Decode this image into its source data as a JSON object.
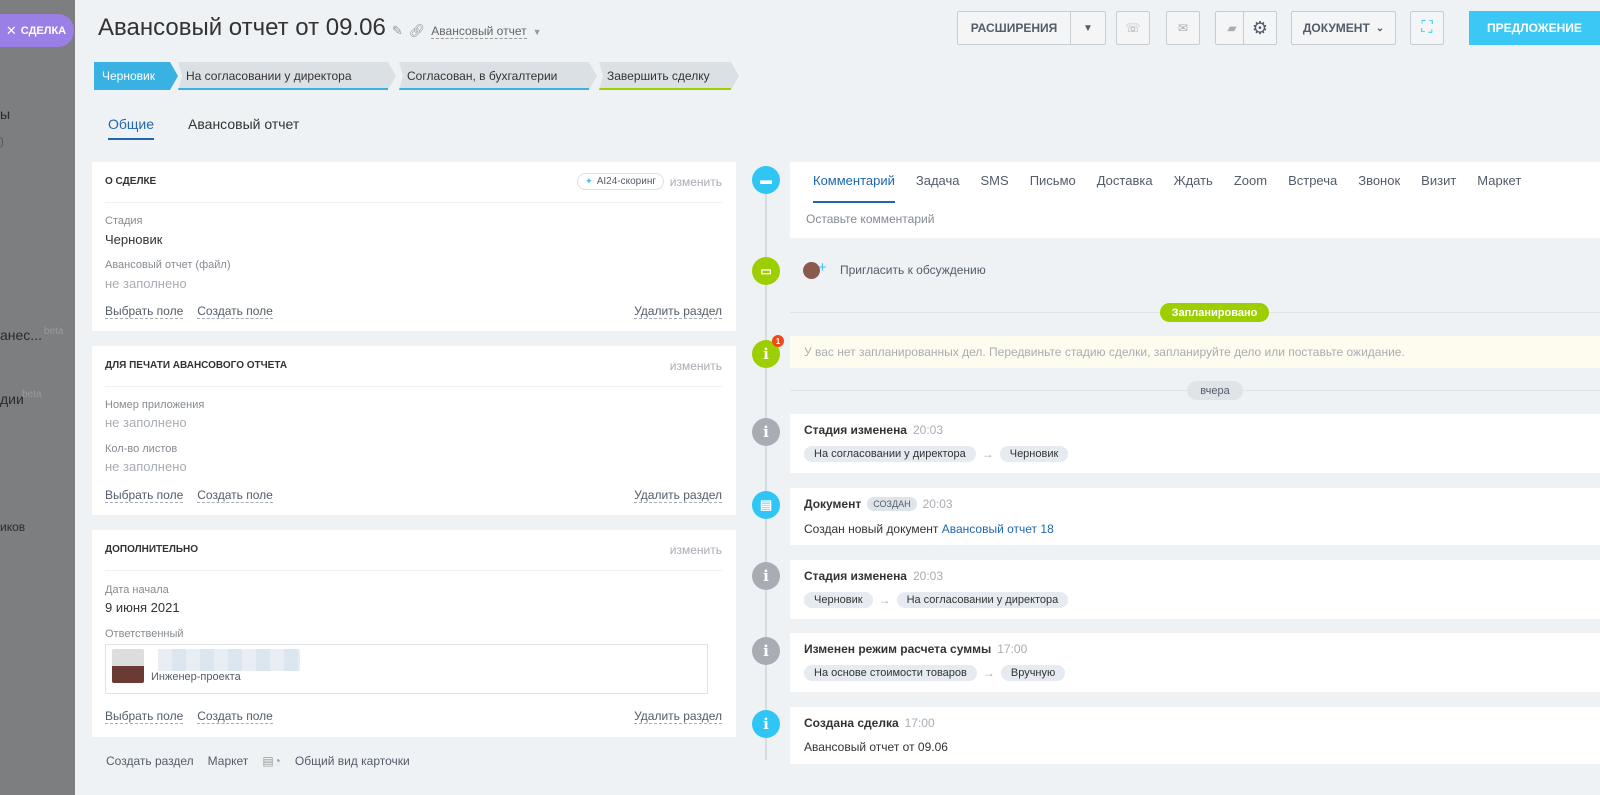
{
  "background": {
    "deal_tab_label": "СДЕЛКА",
    "menu_fragments": [
      "ы",
      ")",
      "анес...",
      "дии",
      "иков"
    ],
    "beta": "beta"
  },
  "header": {
    "title": "Авансовый отчет от  09.06",
    "category": "Авансовый отчет",
    "extensions_button": "Расширения",
    "document_button": "Документ",
    "proposal_button": "Предложение"
  },
  "stages": [
    {
      "label": "Черновик",
      "color": "#3ab1e3"
    },
    {
      "label": "На согласовании у директора",
      "color": "#3ab1e3"
    },
    {
      "label": "Согласован, в бухгалтерии",
      "color": "#3ab1e3"
    },
    {
      "label": "Завершить сделку",
      "color": "#9dcf00"
    }
  ],
  "tabs": [
    {
      "label": "Общие",
      "active": true
    },
    {
      "label": "Авансовый отчет",
      "active": false
    }
  ],
  "sections": {
    "about": {
      "title": "О сделке",
      "ai_badge": "AI24-скоринг",
      "edit": "изменить",
      "fields": [
        {
          "label": "Стадия",
          "value": "Черновик"
        },
        {
          "label": "Авансовый отчет (файл)",
          "value": "не заполнено"
        }
      ],
      "select_field": "Выбрать поле",
      "create_field": "Создать поле",
      "delete_section": "Удалить раздел"
    },
    "print": {
      "title": "Для печати авансового отчета",
      "edit": "изменить",
      "fields": [
        {
          "label": "Номер приложения",
          "value": "не заполнено"
        },
        {
          "label": "Кол-во листов",
          "value": "не заполнено"
        }
      ],
      "select_field": "Выбрать поле",
      "create_field": "Создать поле",
      "delete_section": "Удалить раздел"
    },
    "extra": {
      "title": "Дополнительно",
      "edit": "изменить",
      "start_label": "Дата начала",
      "start_value": "9 июня 2021",
      "resp_label": "Ответственный",
      "resp_role": "Инженер-проекта",
      "select_field": "Выбрать поле",
      "create_field": "Создать поле",
      "delete_section": "Удалить раздел"
    }
  },
  "footer": {
    "create_section": "Создать раздел",
    "market": "Маркет",
    "card_view": "Общий вид карточки"
  },
  "composer": {
    "tabs": [
      "Комментарий",
      "Задача",
      "SMS",
      "Письмо",
      "Доставка",
      "Ждать",
      "Zoom",
      "Встреча",
      "Звонок",
      "Визит",
      "Маркет"
    ],
    "placeholder": "Оставьте комментарий"
  },
  "timeline": {
    "invite": "Пригласить к обсуждению",
    "planned": "Запланировано",
    "notice_badge": "1",
    "notice": "У вас нет запланированных дел. Передвиньте стадию сделки, запланируйте дело или поставьте ожидание.",
    "yesterday": "вчера",
    "events": [
      {
        "title": "Стадия изменена",
        "time": "20:03",
        "from": "На согласовании у директора",
        "to": "Черновик"
      },
      {
        "title": "Документ",
        "tag": "создан",
        "time": "20:03",
        "text": "Создан новый документ ",
        "link": "Авансовый отчет 18"
      },
      {
        "title": "Стадия изменена",
        "time": "20:03",
        "from": "Черновик",
        "to": "На согласовании у директора"
      },
      {
        "title": "Изменен режим расчета суммы",
        "time": "17:00",
        "from": "На основе стоимости товаров",
        "to": "Вручную"
      },
      {
        "title": "Создана сделка",
        "time": "17:00",
        "text": "Авансовый отчет от 09.06"
      }
    ]
  }
}
